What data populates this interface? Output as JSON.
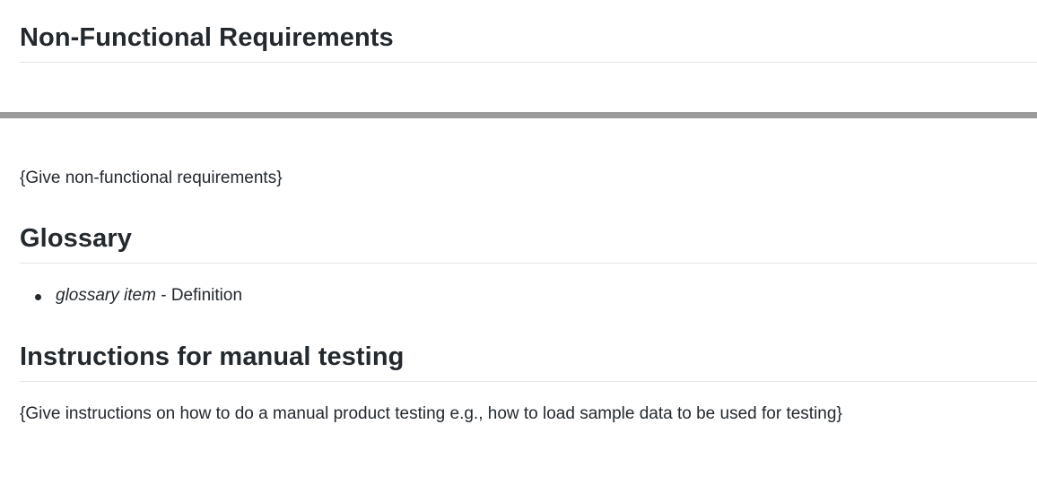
{
  "sections": {
    "nfr": {
      "heading": "Non-Functional Requirements",
      "text": "{Give non-functional requirements}"
    },
    "glossary": {
      "heading": "Glossary",
      "items": [
        {
          "term": "glossary item",
          "separator": " - ",
          "definition": "Definition"
        }
      ]
    },
    "manual_testing": {
      "heading": "Instructions for manual testing",
      "text": "{Give instructions on how to do a manual product testing e.g., how to load sample data to be used for testing}"
    }
  },
  "colors": {
    "text": "#24292e",
    "heading_border": "#e4e6e9",
    "rule": "#9b9b9b",
    "background": "#ffffff"
  }
}
